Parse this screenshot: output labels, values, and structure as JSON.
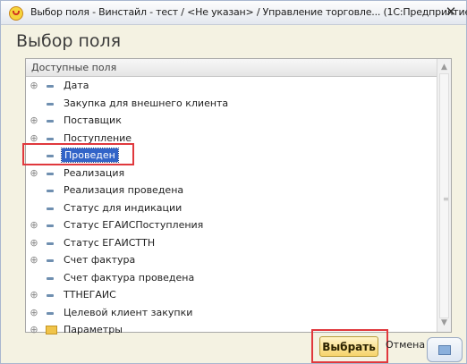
{
  "window": {
    "title": "Выбор поля - Винстайл - тест / <Не указан> / Управление торговле... (1С:Предприятие)",
    "close_label": "✕"
  },
  "dialog": {
    "heading": "Выбор поля",
    "tree_header": "Доступные поля"
  },
  "tree_items": [
    {
      "label": "Дата",
      "expandable": true,
      "icon": "field-icon"
    },
    {
      "label": "Закупка для внешнего клиента",
      "expandable": false,
      "icon": "field-icon"
    },
    {
      "label": "Поставщик",
      "expandable": true,
      "icon": "field-icon"
    },
    {
      "label": "Поступление",
      "expandable": true,
      "icon": "field-icon"
    },
    {
      "label": "Проведен",
      "expandable": false,
      "icon": "field-icon",
      "selected": true
    },
    {
      "label": "Реализация",
      "expandable": true,
      "icon": "field-icon"
    },
    {
      "label": "Реализация проведена",
      "expandable": false,
      "icon": "field-icon"
    },
    {
      "label": "Статус для индикации",
      "expandable": false,
      "icon": "field-icon"
    },
    {
      "label": "Статус ЕГАИСПоступления",
      "expandable": true,
      "icon": "field-icon"
    },
    {
      "label": "Статус ЕГАИСТТН",
      "expandable": true,
      "icon": "field-icon"
    },
    {
      "label": "Счет фактура",
      "expandable": true,
      "icon": "field-icon"
    },
    {
      "label": "Счет фактура проведена",
      "expandable": false,
      "icon": "field-icon"
    },
    {
      "label": "ТТНЕГАИС",
      "expandable": true,
      "icon": "field-icon"
    },
    {
      "label": "Целевой клиент закупки",
      "expandable": true,
      "icon": "field-icon"
    },
    {
      "label": "Параметры",
      "expandable": true,
      "icon": "folder-icon"
    }
  ],
  "buttons": {
    "select": "Выбрать",
    "cancel": "Отмена"
  },
  "colors": {
    "selection": "#3264c8",
    "highlight_box": "#e0383d",
    "primary_button": "#f6d36b"
  }
}
